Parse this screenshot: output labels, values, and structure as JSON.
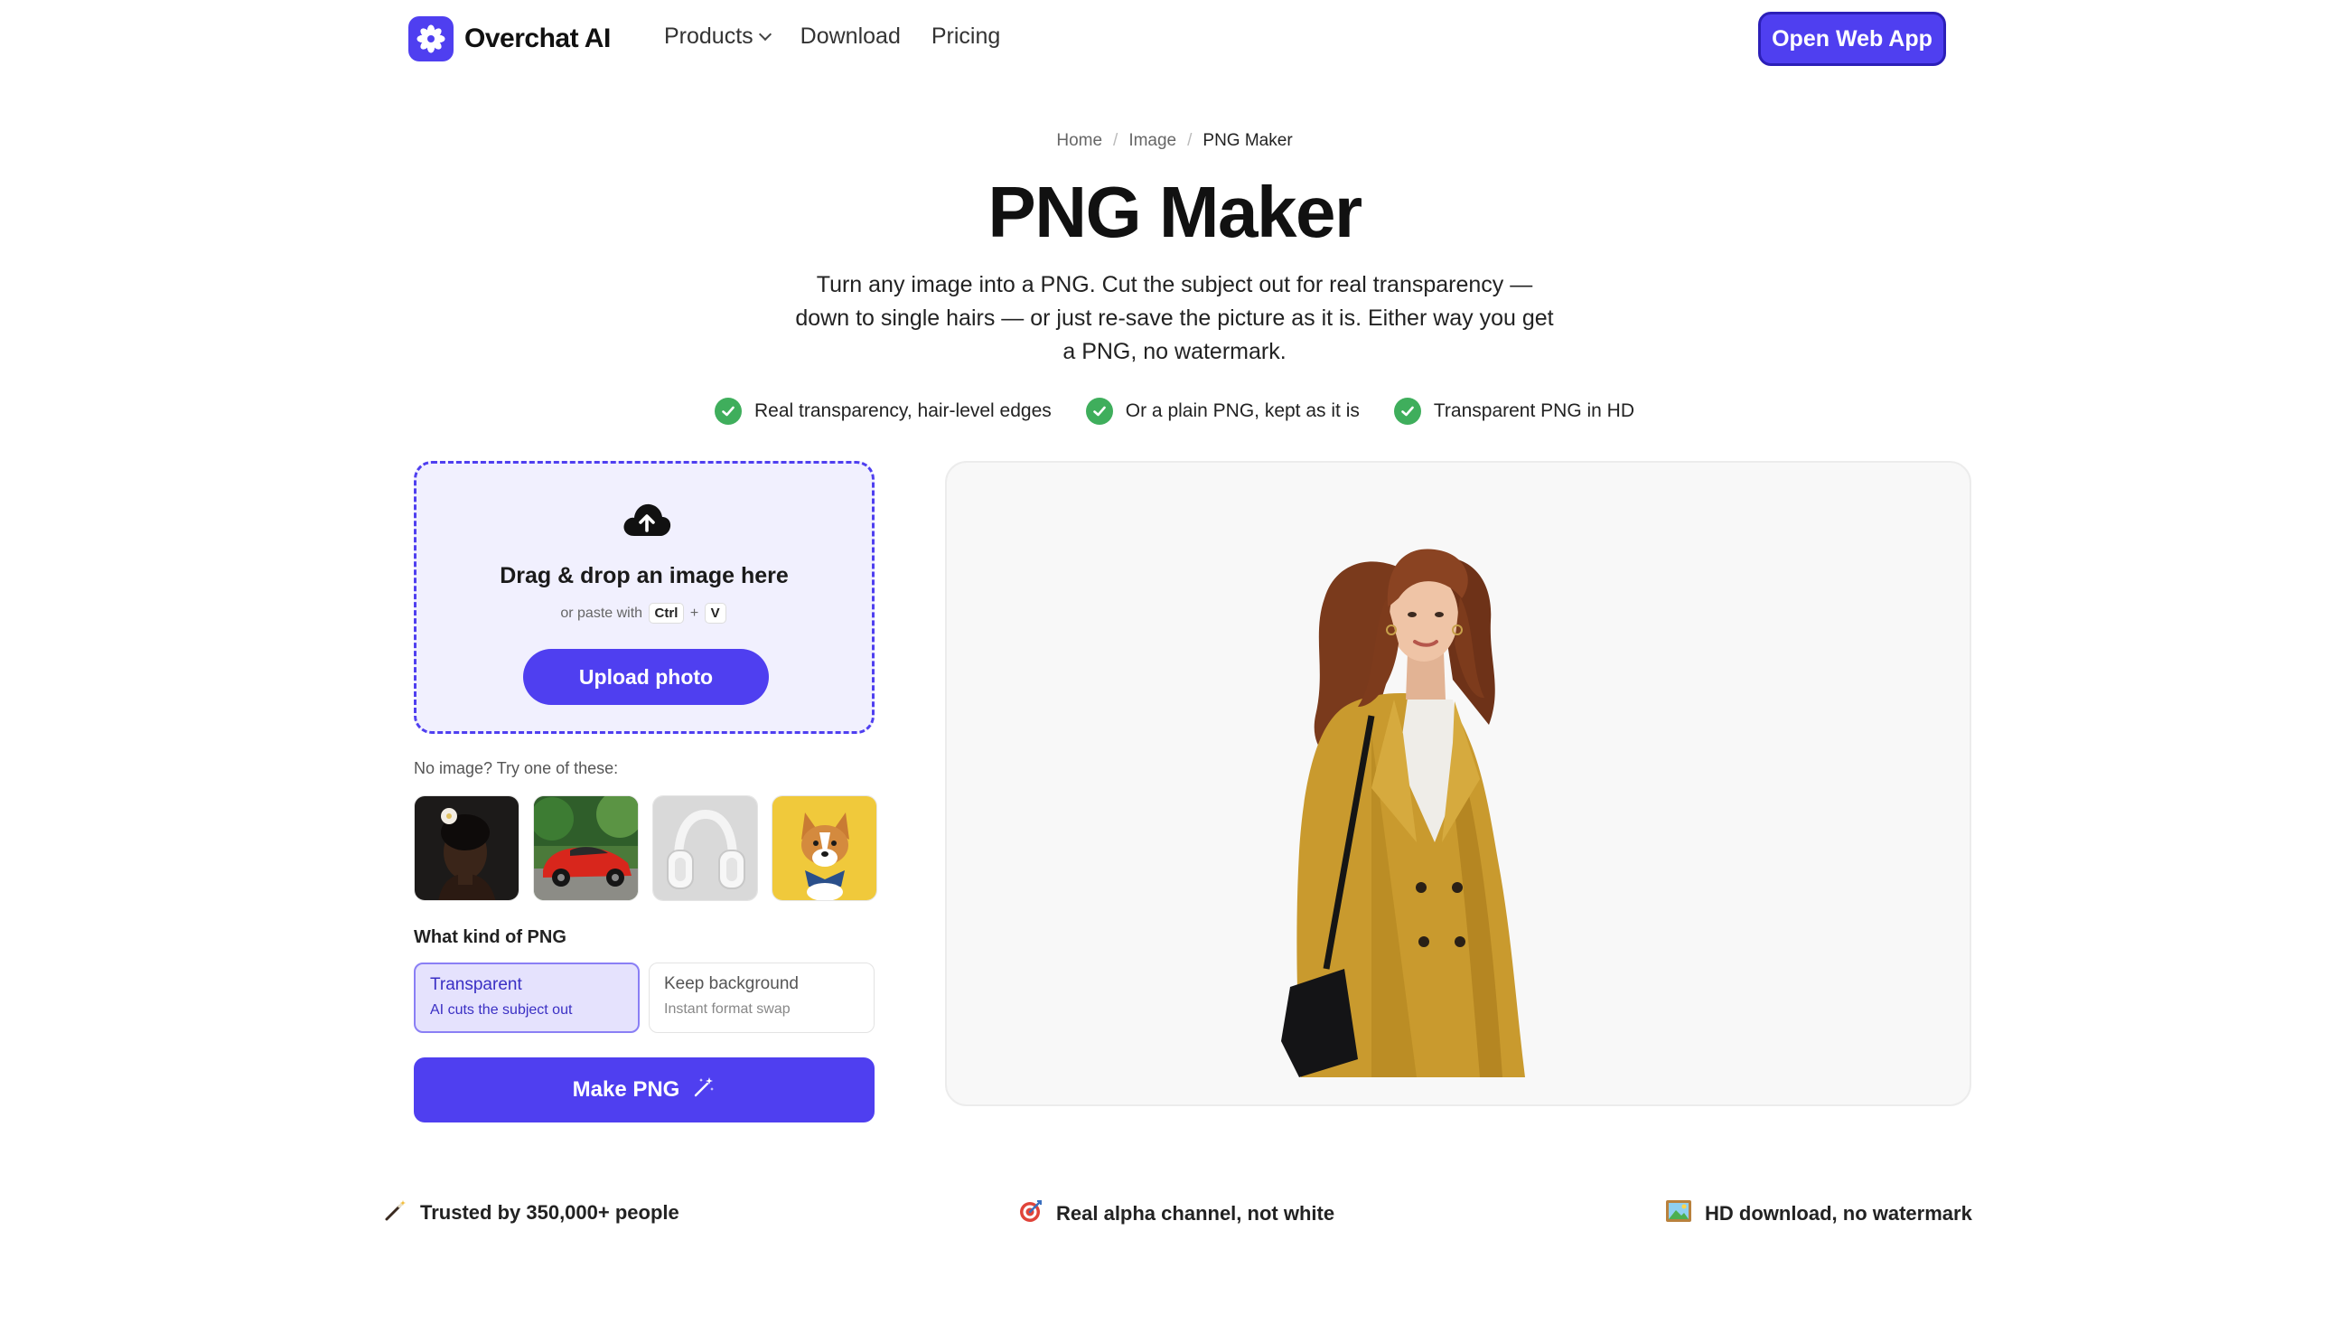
{
  "header": {
    "brand": "Overchat AI",
    "nav": [
      {
        "label": "Products",
        "has_dropdown": true
      },
      {
        "label": "Download"
      },
      {
        "label": "Pricing"
      }
    ],
    "cta": "Open Web App"
  },
  "breadcrumb": {
    "items": [
      "Home",
      "Image",
      "PNG Maker"
    ],
    "separator": "/"
  },
  "hero": {
    "title": "PNG Maker",
    "subtitle": "Turn any image into a PNG. Cut the subject out for real transparency — down to single hairs — or just re-save the picture as it is. Either way you get a PNG, no watermark.",
    "checks": [
      "Real transparency, hair-level edges",
      "Or a plain PNG, kept as it is",
      "Transparent PNG in HD"
    ]
  },
  "uploader": {
    "icon": "cloud-upload-icon",
    "title": "Drag & drop an image here",
    "paste_prefix": "or paste with",
    "key_ctrl": "Ctrl",
    "key_plus": "+",
    "key_v": "V",
    "button": "Upload photo"
  },
  "samples": {
    "label": "No image? Try one of these:",
    "items": [
      "woman-portrait",
      "red-sports-car",
      "white-headphones",
      "corgi-dog"
    ]
  },
  "kind": {
    "label": "What kind of PNG",
    "options": [
      {
        "title": "Transparent",
        "subtitle": "AI cuts the subject out",
        "selected": true
      },
      {
        "title": "Keep background",
        "subtitle": "Instant format swap",
        "selected": false
      }
    ]
  },
  "make_button": "Make PNG",
  "trust": [
    {
      "icon": "magic-wand-icon",
      "text": "Trusted by 350,000+ people"
    },
    {
      "icon": "target-icon",
      "text": "Real alpha channel, not white"
    },
    {
      "icon": "picture-frame-icon",
      "text": "HD download, no watermark"
    }
  ],
  "colors": {
    "accent": "#4f3ff0",
    "check_green": "#3fae5c",
    "dropzone_bg": "#f1f0fe"
  }
}
